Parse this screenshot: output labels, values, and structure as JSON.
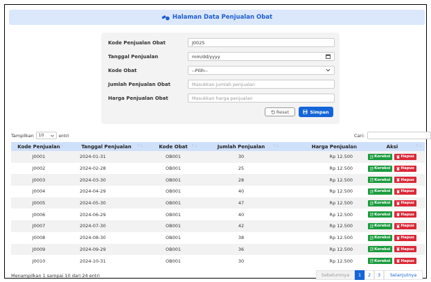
{
  "header": {
    "title": "Halaman Data Penjualan Obat",
    "icon": "pills-icon"
  },
  "form": {
    "kode_label": "Kode Penjualan Obat",
    "kode_value": "J0025",
    "tanggal_label": "Tanggal Penjualan",
    "tanggal_value": "mm/dd/yyyy",
    "obat_label": "Kode Obat",
    "obat_value": "--Pilih--",
    "jumlah_label": "Jumlah Penjualan Obat",
    "jumlah_placeholder": "Masukkan jumlah penjualan",
    "harga_label": "Harga Penjualan Obat",
    "harga_placeholder": "Masukkan harga penjualan",
    "reset_label": "Reset",
    "save_label": "Simpan"
  },
  "table_controls": {
    "show_label": "Tampilkan",
    "show_value": "10",
    "entries_label": "entri",
    "search_label": "Cari:"
  },
  "table": {
    "columns": [
      "Kode Penjualan",
      "Tanggal Penjualan",
      "Kode Obat",
      "Jumlah Penjualan",
      "Harga Penjualan",
      "Aksi"
    ],
    "edit_label": "Koreksi",
    "delete_label": "Hapus",
    "rows": [
      [
        "J0001",
        "2024-01-31",
        "OB001",
        "30",
        "Rp 12.500"
      ],
      [
        "J0002",
        "2024-02-28",
        "OB001",
        "25",
        "Rp 12.500"
      ],
      [
        "J0003",
        "2024-03-30",
        "OB001",
        "28",
        "Rp 12.500"
      ],
      [
        "J0004",
        "2024-04-29",
        "OB001",
        "40",
        "Rp 12.500"
      ],
      [
        "J0005",
        "2024-05-30",
        "OB001",
        "47",
        "Rp 12.500"
      ],
      [
        "J0006",
        "2024-06-29",
        "OB001",
        "40",
        "Rp 12.500"
      ],
      [
        "J0007",
        "2024-07-30",
        "OB001",
        "42",
        "Rp 12.500"
      ],
      [
        "J0008",
        "2024-08-30",
        "OB001",
        "38",
        "Rp 12.500"
      ],
      [
        "J0009",
        "2024-09-29",
        "OB001",
        "36",
        "Rp 12.500"
      ],
      [
        "J0010",
        "2024-10-31",
        "OB001",
        "30",
        "Rp 12.500"
      ]
    ]
  },
  "footer": {
    "info": "Menampilkan 1 sampai 10 dari 24 entri",
    "prev_label": "Sebelumnya",
    "pages": [
      "1",
      "2",
      "3"
    ],
    "next_label": "Selanjutnya"
  },
  "colors": {
    "primary": "#1565d8",
    "success": "#1a9b3d",
    "danger": "#dc2837",
    "header_bg": "#dbe7fb"
  }
}
